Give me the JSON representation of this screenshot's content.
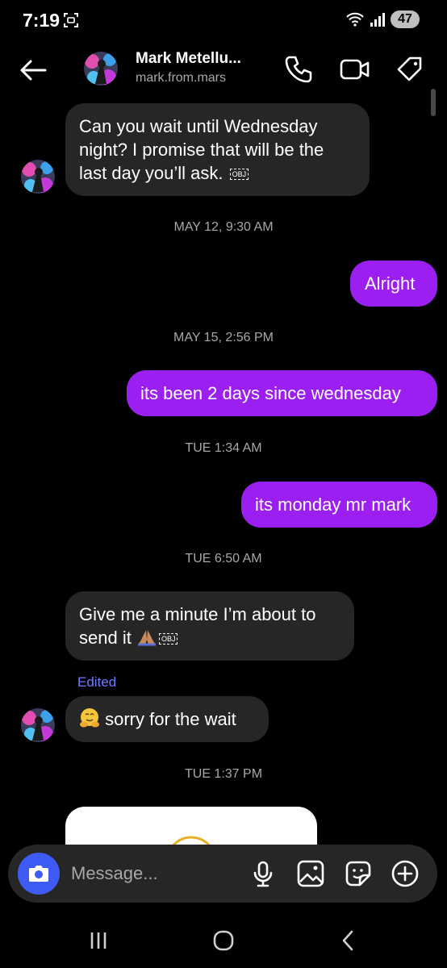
{
  "status": {
    "time": "7:19",
    "battery": "47"
  },
  "header": {
    "name": "Mark Metellu...",
    "username": "mark.from.mars"
  },
  "messages": {
    "m1_line1": "Can you wait until Wednesday",
    "m1_line2": "night? I promise that will be the",
    "m1_line3": "last day you’ll ask.",
    "obj": "OBJ",
    "ts1": "MAY 12, 9:30 AM",
    "m2": "Alright",
    "ts2": "MAY 15, 2:56 PM",
    "m3": "its been 2 days since wednesday",
    "ts3": "TUE 1:34 AM",
    "m4": "its monday mr mark",
    "ts4": "TUE 6:50 AM",
    "m5_line1": "Give me a minute I’m about to",
    "m5_line2": "send it",
    "edited": "Edited",
    "m6": "sorry for the wait",
    "ts5": "TUE 1:37 PM"
  },
  "composer": {
    "placeholder": "Message..."
  },
  "colors": {
    "outgoing": "#9b1ff0",
    "incoming": "#262626",
    "accent": "#3f5bf6",
    "edited": "#6f7cff"
  },
  "icons": [
    "back-arrow-icon",
    "phone-icon",
    "video-camera-icon",
    "tag-icon",
    "camera-icon",
    "microphone-icon",
    "gallery-icon",
    "sticker-icon",
    "plus-icon",
    "recents-icon",
    "home-icon",
    "nav-back-icon"
  ]
}
